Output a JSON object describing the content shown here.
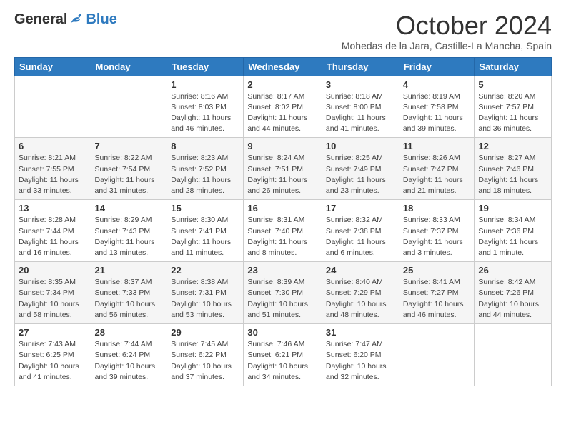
{
  "logo": {
    "general": "General",
    "blue": "Blue"
  },
  "title": "October 2024",
  "subtitle": "Mohedas de la Jara, Castille-La Mancha, Spain",
  "days_of_week": [
    "Sunday",
    "Monday",
    "Tuesday",
    "Wednesday",
    "Thursday",
    "Friday",
    "Saturday"
  ],
  "weeks": [
    [
      {
        "day": "",
        "info": ""
      },
      {
        "day": "",
        "info": ""
      },
      {
        "day": "1",
        "info": "Sunrise: 8:16 AM\nSunset: 8:03 PM\nDaylight: 11 hours and 46 minutes."
      },
      {
        "day": "2",
        "info": "Sunrise: 8:17 AM\nSunset: 8:02 PM\nDaylight: 11 hours and 44 minutes."
      },
      {
        "day": "3",
        "info": "Sunrise: 8:18 AM\nSunset: 8:00 PM\nDaylight: 11 hours and 41 minutes."
      },
      {
        "day": "4",
        "info": "Sunrise: 8:19 AM\nSunset: 7:58 PM\nDaylight: 11 hours and 39 minutes."
      },
      {
        "day": "5",
        "info": "Sunrise: 8:20 AM\nSunset: 7:57 PM\nDaylight: 11 hours and 36 minutes."
      }
    ],
    [
      {
        "day": "6",
        "info": "Sunrise: 8:21 AM\nSunset: 7:55 PM\nDaylight: 11 hours and 33 minutes."
      },
      {
        "day": "7",
        "info": "Sunrise: 8:22 AM\nSunset: 7:54 PM\nDaylight: 11 hours and 31 minutes."
      },
      {
        "day": "8",
        "info": "Sunrise: 8:23 AM\nSunset: 7:52 PM\nDaylight: 11 hours and 28 minutes."
      },
      {
        "day": "9",
        "info": "Sunrise: 8:24 AM\nSunset: 7:51 PM\nDaylight: 11 hours and 26 minutes."
      },
      {
        "day": "10",
        "info": "Sunrise: 8:25 AM\nSunset: 7:49 PM\nDaylight: 11 hours and 23 minutes."
      },
      {
        "day": "11",
        "info": "Sunrise: 8:26 AM\nSunset: 7:47 PM\nDaylight: 11 hours and 21 minutes."
      },
      {
        "day": "12",
        "info": "Sunrise: 8:27 AM\nSunset: 7:46 PM\nDaylight: 11 hours and 18 minutes."
      }
    ],
    [
      {
        "day": "13",
        "info": "Sunrise: 8:28 AM\nSunset: 7:44 PM\nDaylight: 11 hours and 16 minutes."
      },
      {
        "day": "14",
        "info": "Sunrise: 8:29 AM\nSunset: 7:43 PM\nDaylight: 11 hours and 13 minutes."
      },
      {
        "day": "15",
        "info": "Sunrise: 8:30 AM\nSunset: 7:41 PM\nDaylight: 11 hours and 11 minutes."
      },
      {
        "day": "16",
        "info": "Sunrise: 8:31 AM\nSunset: 7:40 PM\nDaylight: 11 hours and 8 minutes."
      },
      {
        "day": "17",
        "info": "Sunrise: 8:32 AM\nSunset: 7:38 PM\nDaylight: 11 hours and 6 minutes."
      },
      {
        "day": "18",
        "info": "Sunrise: 8:33 AM\nSunset: 7:37 PM\nDaylight: 11 hours and 3 minutes."
      },
      {
        "day": "19",
        "info": "Sunrise: 8:34 AM\nSunset: 7:36 PM\nDaylight: 11 hours and 1 minute."
      }
    ],
    [
      {
        "day": "20",
        "info": "Sunrise: 8:35 AM\nSunset: 7:34 PM\nDaylight: 10 hours and 58 minutes."
      },
      {
        "day": "21",
        "info": "Sunrise: 8:37 AM\nSunset: 7:33 PM\nDaylight: 10 hours and 56 minutes."
      },
      {
        "day": "22",
        "info": "Sunrise: 8:38 AM\nSunset: 7:31 PM\nDaylight: 10 hours and 53 minutes."
      },
      {
        "day": "23",
        "info": "Sunrise: 8:39 AM\nSunset: 7:30 PM\nDaylight: 10 hours and 51 minutes."
      },
      {
        "day": "24",
        "info": "Sunrise: 8:40 AM\nSunset: 7:29 PM\nDaylight: 10 hours and 48 minutes."
      },
      {
        "day": "25",
        "info": "Sunrise: 8:41 AM\nSunset: 7:27 PM\nDaylight: 10 hours and 46 minutes."
      },
      {
        "day": "26",
        "info": "Sunrise: 8:42 AM\nSunset: 7:26 PM\nDaylight: 10 hours and 44 minutes."
      }
    ],
    [
      {
        "day": "27",
        "info": "Sunrise: 7:43 AM\nSunset: 6:25 PM\nDaylight: 10 hours and 41 minutes."
      },
      {
        "day": "28",
        "info": "Sunrise: 7:44 AM\nSunset: 6:24 PM\nDaylight: 10 hours and 39 minutes."
      },
      {
        "day": "29",
        "info": "Sunrise: 7:45 AM\nSunset: 6:22 PM\nDaylight: 10 hours and 37 minutes."
      },
      {
        "day": "30",
        "info": "Sunrise: 7:46 AM\nSunset: 6:21 PM\nDaylight: 10 hours and 34 minutes."
      },
      {
        "day": "31",
        "info": "Sunrise: 7:47 AM\nSunset: 6:20 PM\nDaylight: 10 hours and 32 minutes."
      },
      {
        "day": "",
        "info": ""
      },
      {
        "day": "",
        "info": ""
      }
    ]
  ]
}
